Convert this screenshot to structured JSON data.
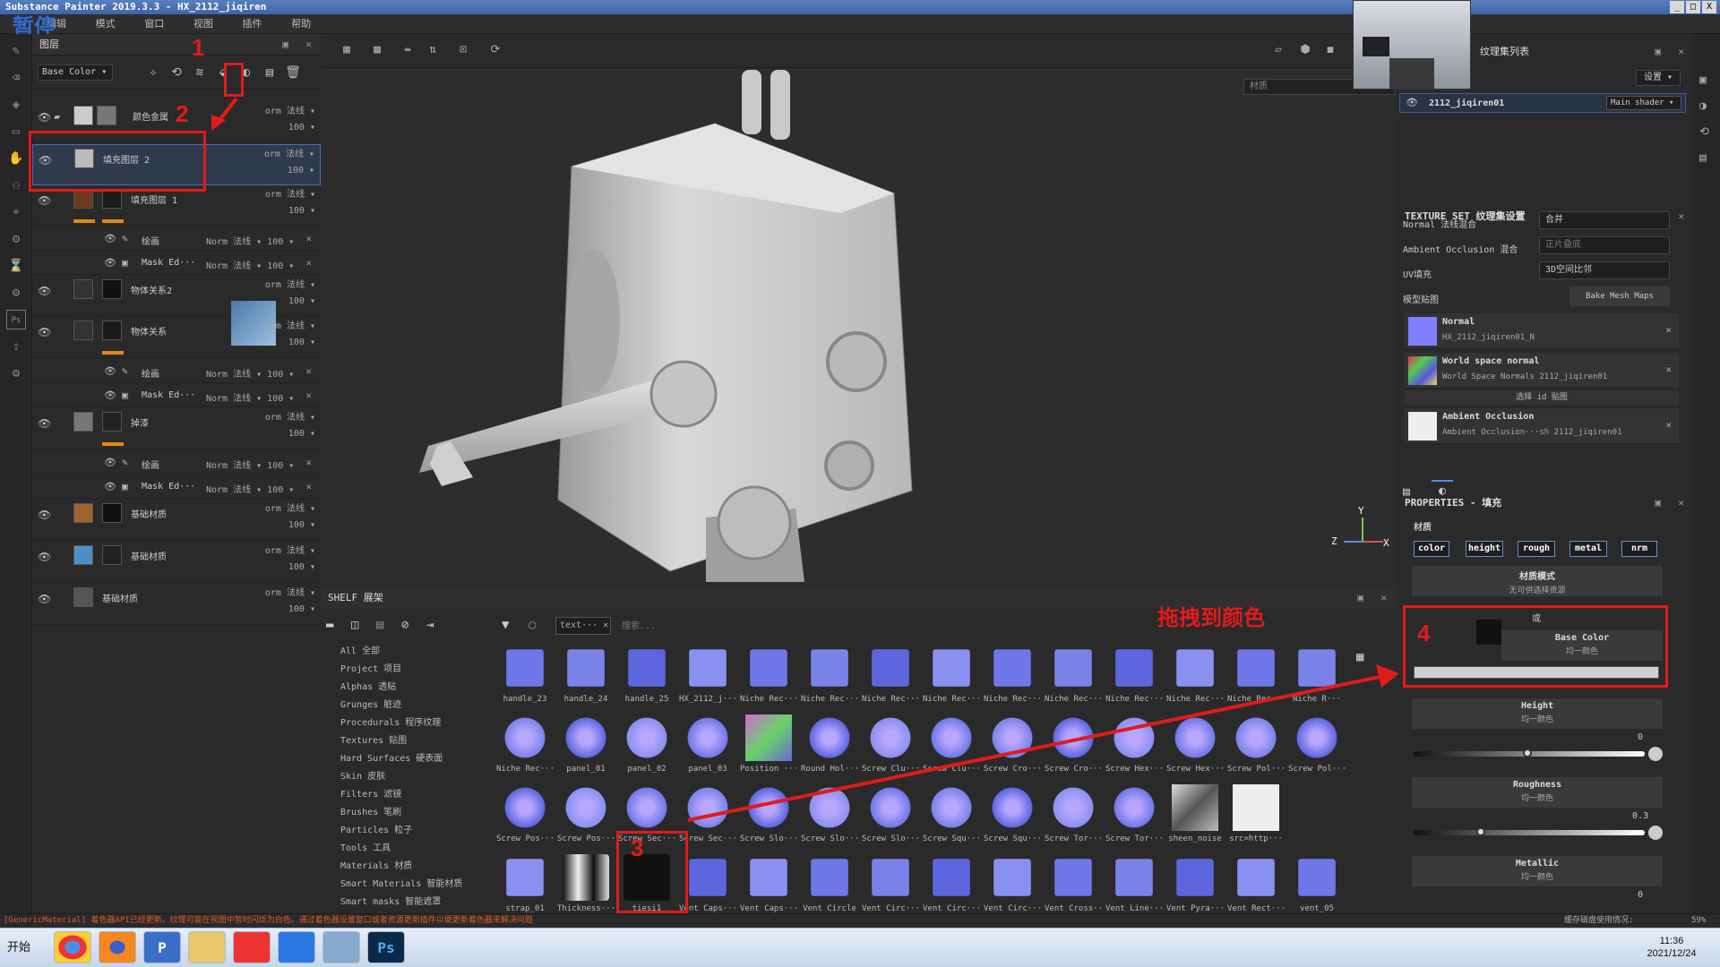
{
  "app": {
    "title": "Substance Painter 2019.3.3 - HX_2112_jiqiren",
    "paused_label": "暂停",
    "menu": [
      "编辑",
      "模式",
      "窗口",
      "视图",
      "插件",
      "帮助"
    ],
    "window_controls": [
      "_",
      "□",
      "X"
    ]
  },
  "layers_panel": {
    "title": "图层",
    "channel_select": "Base Color",
    "layers": [
      {
        "name": "颜色金属",
        "blend": "orm 法线",
        "opacity": "100"
      },
      {
        "name": "填充图层 2",
        "blend": "orm 法线",
        "opacity": "100"
      },
      {
        "name": "填充图层 1",
        "blend": "orm 法线",
        "opacity": "100"
      },
      {
        "name": "物体关系2",
        "blend": "orm 法线",
        "opacity": "100"
      },
      {
        "name": "物体关系",
        "blend": "orm 法线",
        "opacity": "100"
      },
      {
        "name": "掉漆",
        "blend": "orm 法线",
        "opacity": "100"
      },
      {
        "name": "基础材质",
        "blend": "orm 法线",
        "opacity": "100"
      },
      {
        "name": "基础材质",
        "blend": "orm 法线",
        "opacity": "100"
      },
      {
        "name": "基础材质",
        "blend": "orm 法线",
        "opacity": "100"
      }
    ],
    "sublayers": {
      "paint": "绘画",
      "mask": "Mask Ed···",
      "blend": "Norm 法线",
      "opacity": "100"
    }
  },
  "viewport": {
    "material_field": "材质",
    "axis_labels": {
      "y": "Y",
      "z": "Z",
      "x": "X"
    }
  },
  "shelf": {
    "title": "SHELF 展架",
    "filter_tag": "text···",
    "search_placeholder": "搜索...",
    "categories": [
      "All 全部",
      "Project 项目",
      "Alphas 透贴",
      "Grunges 脏迹",
      "Procedurals 程序纹理",
      "Textures 贴图",
      "Hard Surfaces 硬表面",
      "Skin 皮肤",
      "Filters 滤镜",
      "Brushes 笔刷",
      "Particles 粒子",
      "Tools 工具",
      "Materials 材质",
      "Smart Materials 智能材质",
      "Smart masks 智能遮罩"
    ],
    "rows": [
      [
        "handle_23",
        "handle_24",
        "handle_25",
        "HX_2112_j···",
        "Niche Rec···",
        "Niche Rec···",
        "Niche Rec···",
        "Niche Rec···",
        "Niche Rec···",
        "Niche Rec···",
        "Niche Rec···",
        "Niche Rec···",
        "Niche Rec···",
        "Niche R···"
      ],
      [
        "Niche Rec···",
        "panel_01",
        "panel_02",
        "panel_03",
        "Position ···",
        "Round Hol···",
        "Screw Clu···",
        "Screw Clu···",
        "Screw Cro···",
        "Screw Cro···",
        "Screw Hex···",
        "Screw Hex···",
        "Screw Pol···",
        "Screw Pol···"
      ],
      [
        "Screw Pos···",
        "Screw Pos···",
        "Screw Sec···",
        "Screw Sec···",
        "Screw Slo···",
        "Screw Slo···",
        "Screw Slo···",
        "Screw Squ···",
        "Screw Squ···",
        "Screw Tor···",
        "Screw Tor···",
        "sheen_noise",
        "src=http···"
      ],
      [
        "strap_01",
        "Thickness···",
        "tiesi1",
        "Vent Caps···",
        "Vent Caps···",
        "Vent Circle",
        "Vent Circ···",
        "Vent Circ···",
        "Vent Circ···",
        "Vent Cross···",
        "Vent Line···",
        "Vent Pyra···",
        "Vent Rect···",
        "vent_05"
      ]
    ]
  },
  "right_panel": {
    "texture_set_list_title": "纹理集列表",
    "settings_button": "设置",
    "texture_set_name": "2112_jiqiren01",
    "shader_select": "Main shader",
    "texture_set_settings_title": "TEXTURE SET 纹理集设置",
    "normal_blend_label": "Normal 法线混合",
    "normal_blend_value": "合并",
    "ao_blend_label": "Ambient Occlusion 混合",
    "ao_blend_value": "正片叠底",
    "uv_fill_label": "UV填充",
    "uv_fill_value": "3D空间比邻",
    "model_maps_label": "模型贴图",
    "bake_button": "Bake Mesh Maps",
    "maps": [
      {
        "title": "Normal",
        "sub": "HX_2112_jiqiren01_N"
      },
      {
        "title": "World space normal",
        "sub": "World Space Normals 2112_jiqiren01"
      },
      {
        "title": "Ambient Occlusion",
        "sub": "Ambient Occlusion···sh 2112_jiqiren01"
      }
    ],
    "select_id_map": "选择 id 贴图",
    "properties_title": "PROPERTIES - 填充",
    "material_label": "材质",
    "channels": [
      "color",
      "height",
      "rough",
      "metal",
      "nrm"
    ],
    "material_mode_title": "材质模式",
    "material_mode_sub": "无可供选择资源",
    "or_label": "或",
    "base_color_title": "Base Color",
    "base_color_sub": "均一颜色",
    "height_title": "Height",
    "height_sub": "均一颜色",
    "height_value": "0",
    "roughness_title": "Roughness",
    "roughness_sub": "均一颜色",
    "roughness_value": "0.3",
    "metallic_title": "Metallic",
    "metallic_sub": "均一颜色",
    "metallic_value": "0"
  },
  "annotations": {
    "num1": "1",
    "num2": "2",
    "num3": "3",
    "num4": "4",
    "drag_hint": "拖拽到颜色"
  },
  "status_bar": {
    "message": "[GenericMaterial] 着色器API已经更新。纹理可能在视图中暂时闪烁为白色。通过着色器设置窗口或者资源更新插件以便更新着色器来解决问题",
    "right": "缓存磁盘使用情况:",
    "percent": "59%"
  },
  "taskbar": {
    "start_label": "开始",
    "apps": [
      "chrome-icon",
      "firefox-icon",
      "p-app-icon",
      "folder-icon",
      "substance-icon",
      "feather-icon",
      "notepad-icon",
      "photoshop-icon"
    ],
    "app_labels": {
      "p": "P",
      "ps": "Ps"
    },
    "time": "11:36",
    "date": "2021/12/24"
  }
}
